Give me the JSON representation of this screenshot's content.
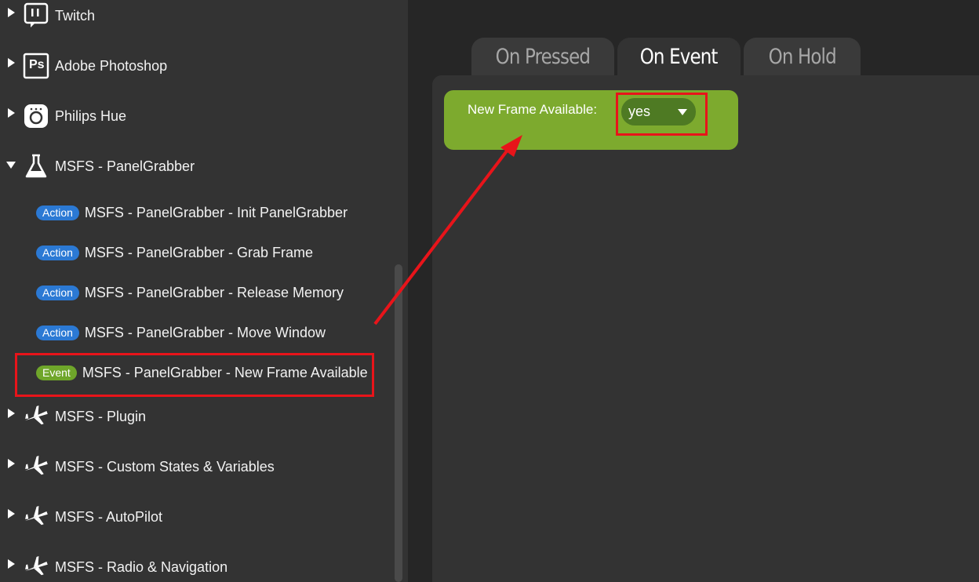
{
  "sidebar": {
    "categories": [
      {
        "label": "Twitch",
        "icon": "twitch-icon",
        "expanded": false
      },
      {
        "label": "Adobe Photoshop",
        "icon": "photoshop-icon",
        "icon_text": "Ps",
        "expanded": false
      },
      {
        "label": "Philips Hue",
        "icon": "philips-hue-icon",
        "expanded": false
      },
      {
        "label": "MSFS - PanelGrabber",
        "icon": "flask-icon",
        "expanded": true
      },
      {
        "label": "MSFS - Plugin",
        "icon": "airplane-icon",
        "expanded": false
      },
      {
        "label": "MSFS - Custom States & Variables",
        "icon": "airplane-icon",
        "expanded": false
      },
      {
        "label": "MSFS - AutoPilot",
        "icon": "airplane-icon",
        "expanded": false
      },
      {
        "label": "MSFS - Radio & Navigation",
        "icon": "airplane-icon",
        "expanded": false
      }
    ],
    "panelgrabber_items": [
      {
        "badge": "Action",
        "label": "MSFS - PanelGrabber - Init PanelGrabber"
      },
      {
        "badge": "Action",
        "label": "MSFS - PanelGrabber - Grab Frame"
      },
      {
        "badge": "Action",
        "label": "MSFS - PanelGrabber - Release Memory"
      },
      {
        "badge": "Action",
        "label": "MSFS - PanelGrabber - Move Window"
      },
      {
        "badge": "Event",
        "label": "MSFS - PanelGrabber - New Frame Available",
        "highlighted": true
      }
    ]
  },
  "tabs": [
    {
      "label": "On Pressed",
      "active": false
    },
    {
      "label": "On Event",
      "active": true
    },
    {
      "label": "On Hold",
      "active": false
    }
  ],
  "event_block": {
    "field_label": "New Frame Available:",
    "dropdown_value": "yes"
  },
  "colors": {
    "action_badge": "#2b79d4",
    "event_badge": "#6fa62a",
    "event_block": "#7daa2e",
    "annotation_red": "#e8141a"
  }
}
